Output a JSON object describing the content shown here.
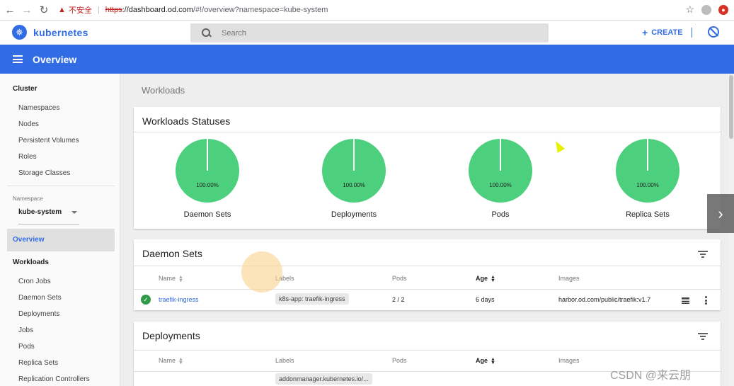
{
  "browser": {
    "warn_icon": "warning-triangle-icon",
    "insecure_label": "不安全",
    "url_scheme": "https",
    "url_host": "://dashboard.od.com",
    "url_rest": "/#!/overview?namespace=kube-system"
  },
  "header": {
    "brand": "kubernetes",
    "search_placeholder": "Search",
    "create_label": "CREATE"
  },
  "toolbar": {
    "title": "Overview"
  },
  "sidebar": {
    "cluster_heading": "Cluster",
    "cluster_items": [
      "Namespaces",
      "Nodes",
      "Persistent Volumes",
      "Roles",
      "Storage Classes"
    ],
    "namespace_label": "Namespace",
    "namespace_value": "kube-system",
    "overview_label": "Overview",
    "workloads_heading": "Workloads",
    "workload_items": [
      "Cron Jobs",
      "Daemon Sets",
      "Deployments",
      "Jobs",
      "Pods",
      "Replica Sets",
      "Replication Controllers"
    ]
  },
  "main": {
    "section_title": "Workloads",
    "statuses": {
      "title": "Workloads Statuses",
      "pies": [
        {
          "label": "Daemon Sets",
          "value": "100.00%"
        },
        {
          "label": "Deployments",
          "value": "100.00%"
        },
        {
          "label": "Pods",
          "value": "100.00%"
        },
        {
          "label": "Replica Sets",
          "value": "100.00%"
        }
      ]
    },
    "daemon_sets": {
      "title": "Daemon Sets",
      "headers": {
        "name": "Name",
        "labels": "Labels",
        "pods": "Pods",
        "age": "Age",
        "images": "Images"
      },
      "rows": [
        {
          "name": "traefik-ingress",
          "label": "k8s-app: traefik-ingress",
          "pods": "2 / 2",
          "age": "6 days",
          "image": "harbor.od.com/public/traefik:v1.7"
        }
      ]
    },
    "deployments": {
      "title": "Deployments",
      "headers": {
        "name": "Name",
        "labels": "Labels",
        "pods": "Pods",
        "age": "Age",
        "images": "Images"
      },
      "rows": [
        {
          "label": "addonmanager.kubernetes.io/..."
        }
      ]
    }
  },
  "watermark": "CSDN @来云朋",
  "colors": {
    "accent": "#326ce5",
    "pie": "#4cd07d",
    "ok": "#2e9b48"
  }
}
